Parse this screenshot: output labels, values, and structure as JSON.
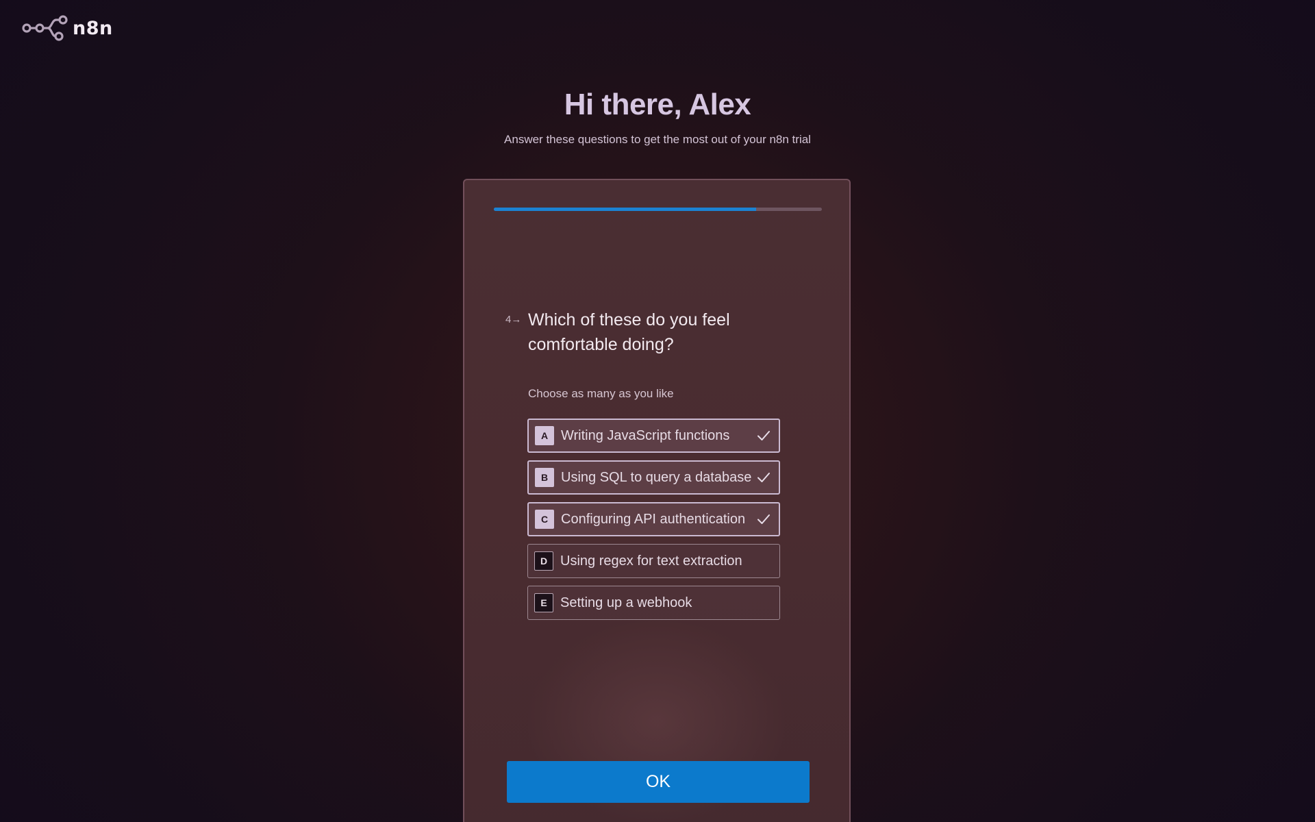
{
  "brand": {
    "logo_icon": "n8n-nodes-logo-icon",
    "name": "n8n"
  },
  "header": {
    "greeting": "Hi there, Alex",
    "subtitle": "Answer these questions to get the most out of your n8n trial"
  },
  "progress": {
    "fraction": 0.8,
    "fill_color": "#1b82d2"
  },
  "question": {
    "number": "4→",
    "text": "Which of these do you feel comfortable doing?",
    "hint": "Choose as many as you like",
    "options": [
      {
        "key": "A",
        "label": "Writing JavaScript functions",
        "selected": true
      },
      {
        "key": "B",
        "label": "Using SQL to query a database",
        "selected": true
      },
      {
        "key": "C",
        "label": "Configuring API authentication",
        "selected": true
      },
      {
        "key": "D",
        "label": "Using regex for text extraction",
        "selected": false
      },
      {
        "key": "E",
        "label": "Setting up a webhook",
        "selected": false
      }
    ]
  },
  "actions": {
    "ok_label": "OK",
    "ok_color": "#0c7acc"
  }
}
